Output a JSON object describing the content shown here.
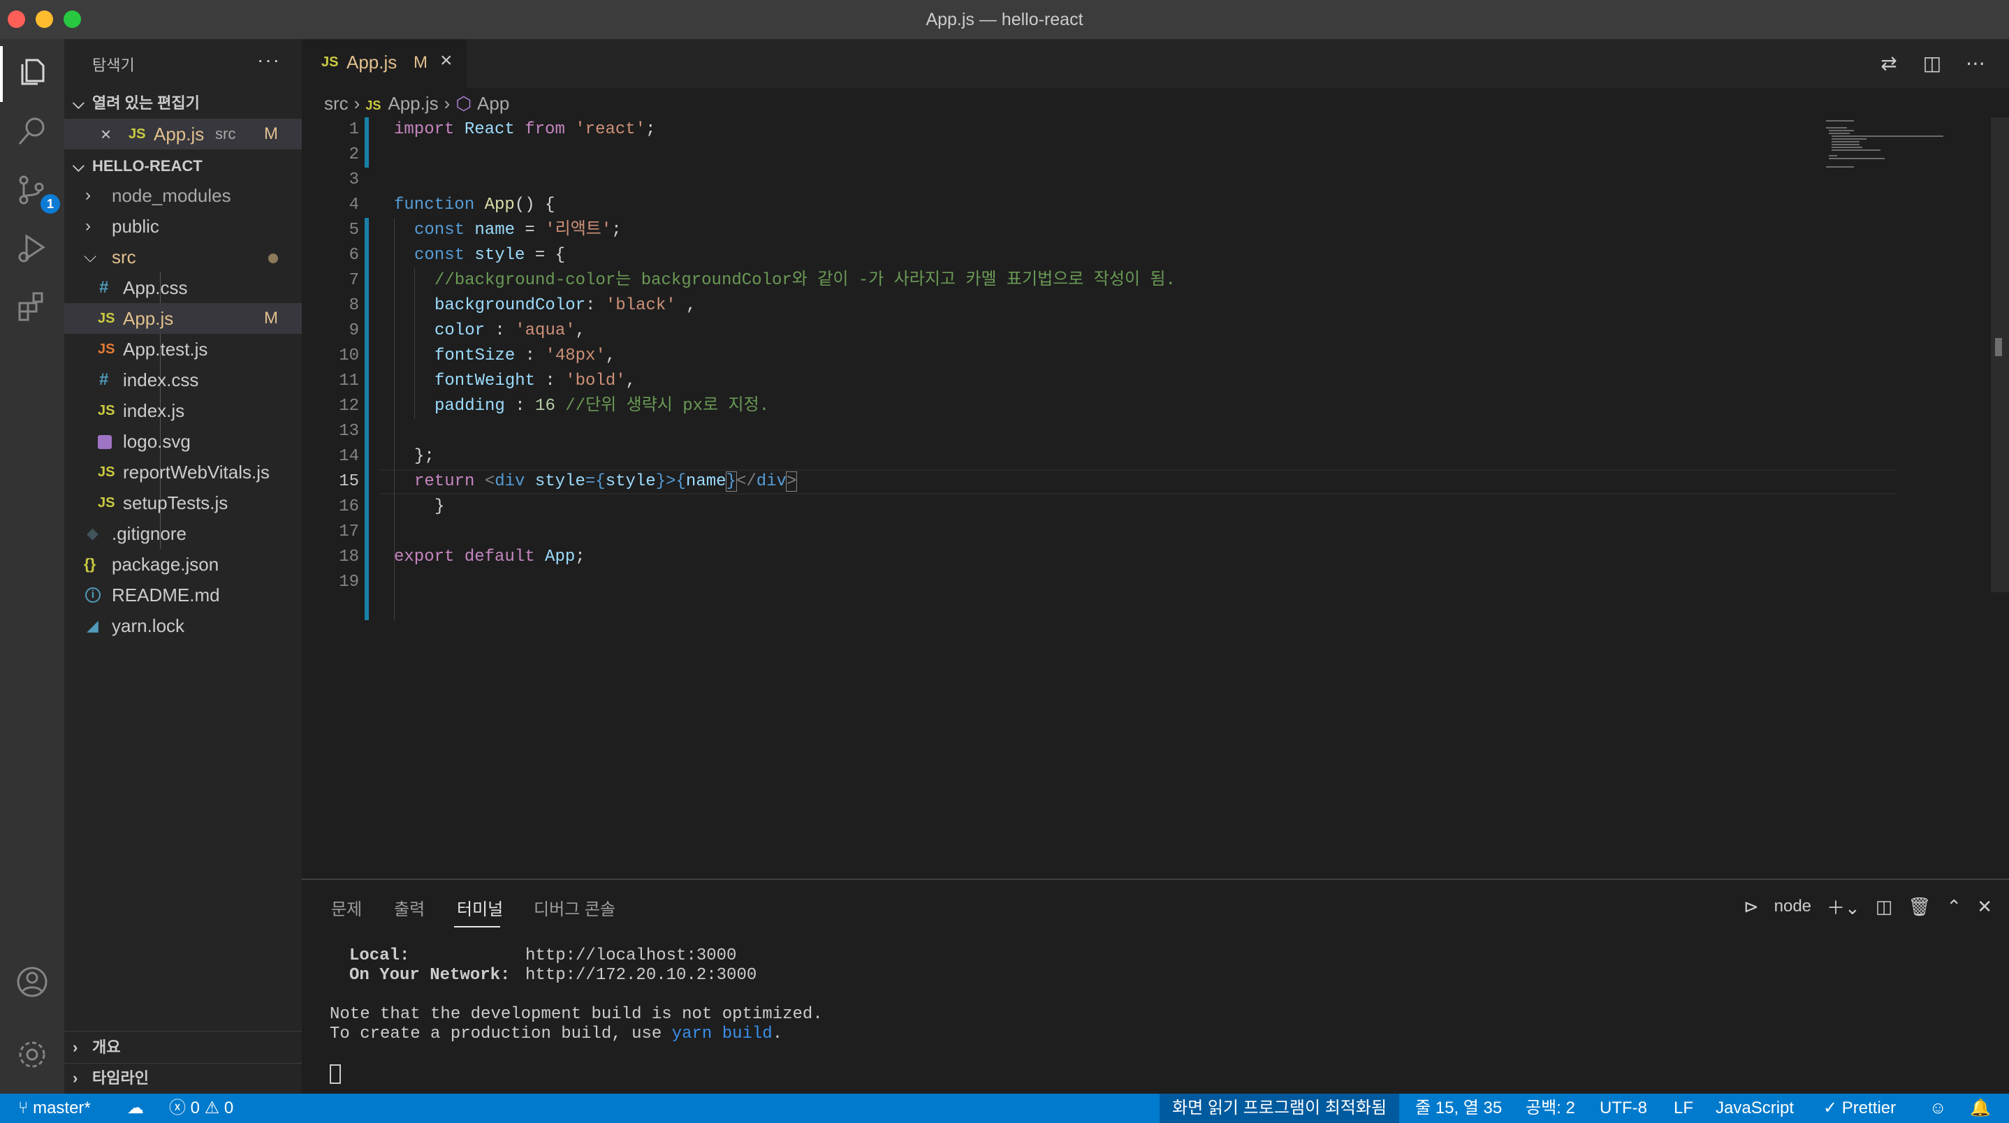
{
  "window": {
    "title": "App.js — hello-react"
  },
  "activity": {
    "scm_badge": "1"
  },
  "sidebar": {
    "header": "탐색기",
    "more": "···",
    "open_editors": {
      "title": "열려 있는 편집기",
      "items": [
        {
          "icon": "JS",
          "name": "App.js",
          "folder": "src",
          "flag": "M"
        }
      ]
    },
    "project": {
      "title": "HELLO-REACT",
      "items": [
        {
          "name": "node_modules",
          "type": "folder"
        },
        {
          "name": "public",
          "type": "folder"
        },
        {
          "name": "src",
          "type": "folder-open"
        },
        {
          "name": "App.css",
          "icon": "#"
        },
        {
          "name": "App.js",
          "icon": "JS",
          "flag": "M"
        },
        {
          "name": "App.test.js",
          "icon": "JS"
        },
        {
          "name": "index.css",
          "icon": "#"
        },
        {
          "name": "index.js",
          "icon": "JS"
        },
        {
          "name": "logo.svg",
          "icon": "svg"
        },
        {
          "name": "reportWebVitals.js",
          "icon": "JS"
        },
        {
          "name": "setupTests.js",
          "icon": "JS"
        },
        {
          "name": ".gitignore",
          "icon": "git"
        },
        {
          "name": "package.json",
          "icon": "{}"
        },
        {
          "name": "README.md",
          "icon": "i"
        },
        {
          "name": "yarn.lock",
          "icon": "yarn"
        }
      ]
    },
    "outline": "개요",
    "timeline": "타임라인"
  },
  "tab": {
    "icon": "JS",
    "name": "App.js",
    "flag": "M"
  },
  "breadcrumb": {
    "folder": "src",
    "file_icon": "JS",
    "file": "App.js",
    "symbol": "App"
  },
  "code": {
    "line_numbers": [
      "1",
      "2",
      "3",
      "4",
      "5",
      "6",
      "7",
      "8",
      "9",
      "10",
      "11",
      "12",
      "13",
      "14",
      "15",
      "16",
      "17",
      "18",
      "19"
    ],
    "current_line": "15",
    "lines": {
      "l1": {
        "a": "import",
        "b": " React ",
        "c": "from",
        "d": " 'react'",
        "e": ";"
      },
      "l4": {
        "a": "function",
        "b": " App",
        "c": "() {"
      },
      "l5": {
        "a": "const",
        "b": " name",
        "c": " = ",
        "d": "'리액트'",
        "e": ";"
      },
      "l6": {
        "a": "const",
        "b": " style",
        "c": " = {"
      },
      "l7": {
        "a": "//background-color는 backgroundColor와 같이 -가 사라지고 카멜 표기법으로 작성이 됨."
      },
      "l8": {
        "a": "backgroundColor",
        "b": ": ",
        "c": "'black'",
        "d": " ,"
      },
      "l9": {
        "a": "color",
        "b": " : ",
        "c": "'aqua'",
        "d": ","
      },
      "l10": {
        "a": "fontSize",
        "b": " : ",
        "c": "'48px'",
        "d": ","
      },
      "l11": {
        "a": "fontWeight",
        "b": " : ",
        "c": "'bold'",
        "d": ","
      },
      "l12": {
        "a": "padding",
        "b": " : ",
        "c": "16",
        "d": " //단위 생략시 px로 지정."
      },
      "l14": {
        "a": "};"
      },
      "l15": {
        "a": "return",
        "b": " <",
        "c": "div",
        "d": " style",
        "e": "={",
        "f": "style",
        "g": "}>",
        "h": "{",
        "i": "name",
        "j": "}",
        "k": "</",
        "l": "div",
        "m": ">"
      },
      "l16": {
        "a": "}"
      },
      "l18": {
        "a": "export",
        "b": " ",
        "c": "default",
        "d": " App",
        "e": ";"
      }
    }
  },
  "panel": {
    "tabs": [
      "문제",
      "출력",
      "터미널",
      "디버그 콘솔"
    ],
    "active_tab": "터미널",
    "shell": "node",
    "terminal": {
      "local_label": "Local:",
      "local_url": "http://localhost:3000",
      "network_label": "On Your Network:",
      "network_url": "http://172.20.10.2:3000",
      "note": "Note that the development build is not optimized.",
      "build_prefix": "To create a production build, use ",
      "build_cmd": "yarn build",
      "build_suffix": "."
    }
  },
  "statusbar": {
    "branch": "master*",
    "errors": "0",
    "warnings": "0",
    "a11y": "화면 읽기 프로그램이 최적화됨",
    "position": "줄 15, 열 35",
    "spaces": "공백: 2",
    "encoding": "UTF-8",
    "eol": "LF",
    "language": "JavaScript",
    "prettier": "Prettier"
  },
  "colors": {
    "accent": "#007acc",
    "modified": "#e2c08d",
    "js_icon": "#cbcb41",
    "css_icon": "#519aba"
  }
}
